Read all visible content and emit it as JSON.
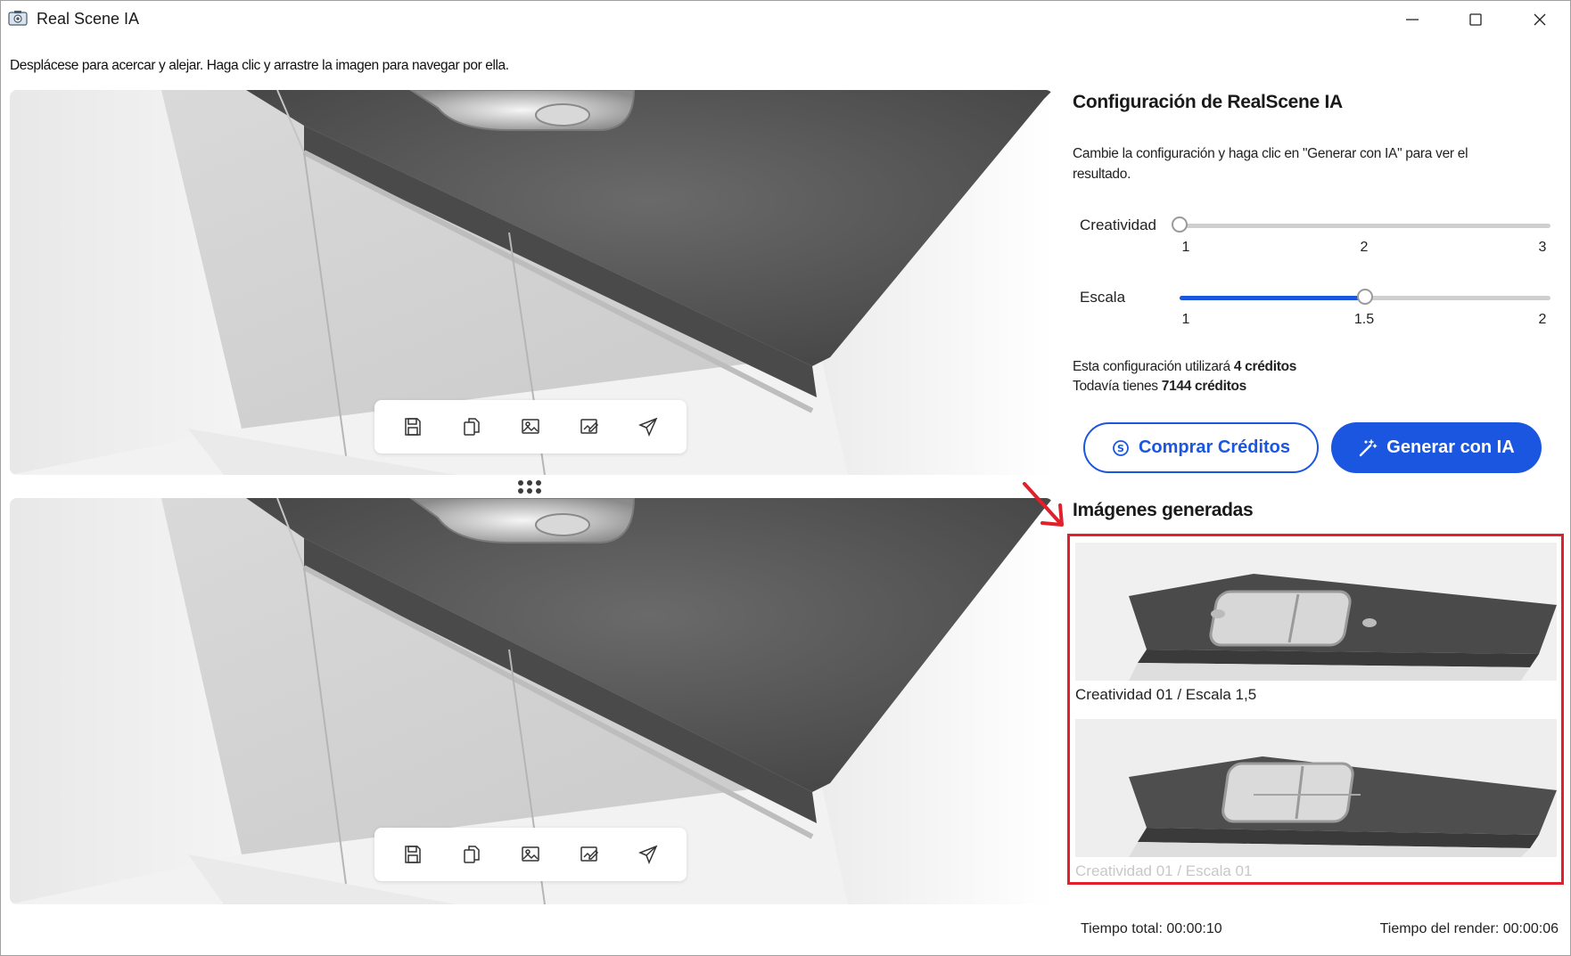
{
  "window": {
    "title": "Real Scene IA",
    "controls": [
      "minimize",
      "maximize",
      "close"
    ]
  },
  "hint": "Desplácese para acercar y alejar. Haga clic y arrastre la imagen para navegar por ella.",
  "toolbar": {
    "icons": [
      "save-icon",
      "copy-icon",
      "image-icon",
      "edit-image-icon",
      "send-icon"
    ]
  },
  "panel": {
    "title": "Configuración de RealScene IA",
    "description": "Cambie la configuración y haga clic en \"Generar con IA\" para ver el resultado.",
    "creatividad": {
      "label": "Creatividad",
      "min": 1,
      "max": 3,
      "value": 1,
      "ticks": [
        "1",
        "2",
        "3"
      ]
    },
    "escala": {
      "label": "Escala",
      "min": 1,
      "max": 2,
      "value": 1.5,
      "ticks": [
        "1",
        "1.5",
        "2"
      ]
    },
    "credits": {
      "uses_prefix": "Esta configuración utilizará ",
      "uses_value": "4 créditos",
      "have_prefix": "Todavía tienes ",
      "have_value": "7144 créditos"
    },
    "buy_label": "Comprar Créditos",
    "generate_label": "Generar con IA",
    "accent_color": "#1a56e0",
    "generated_title": "Imágenes generadas",
    "generated": [
      {
        "caption": "Creatividad 01 / Escala 1,5"
      },
      {
        "caption": "Creatividad 01 / Escala 01"
      }
    ],
    "highlight_color": "#e0202a"
  },
  "status": {
    "total": "Tiempo total: 00:00:10",
    "render": "Tiempo del render: 00:00:06"
  }
}
